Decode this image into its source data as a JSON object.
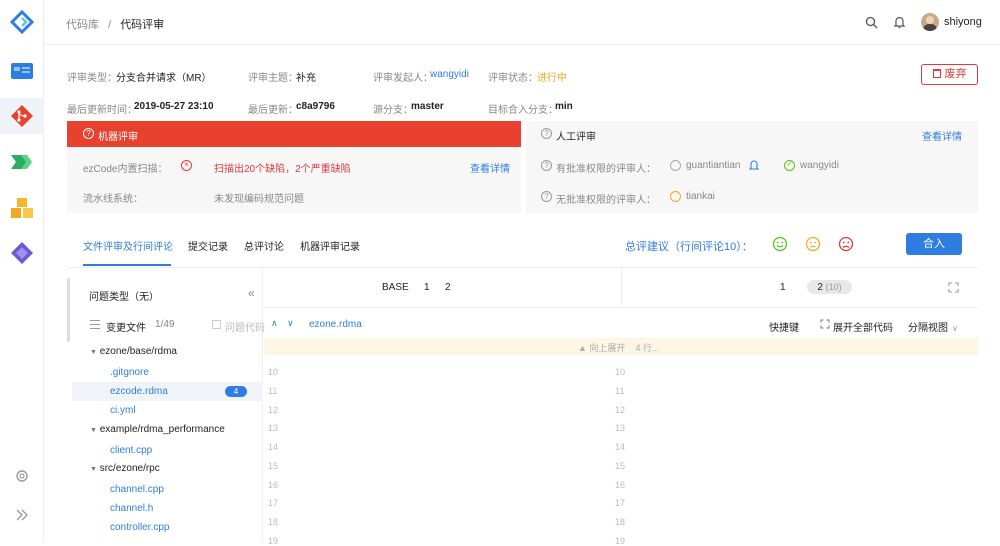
{
  "breadcrumb": {
    "root": "代码库",
    "sep": "/",
    "current": "代码评审"
  },
  "user": {
    "name": "shiyong"
  },
  "review": {
    "type_label": "评审类型：",
    "type_value": "分支合并请求（MR）",
    "topic_label": "评审主题：",
    "topic_value": "补充",
    "initiator_label": "评审发起人：",
    "initiator_value": "wangyidi",
    "status_label": "评审状态：",
    "status_value": "进行中",
    "updated_time_label": "最后更新时间：",
    "updated_time_value": "2019-05-27 23:10",
    "last_update_label": "最后更新：",
    "last_update_value": "c8a9796",
    "source_branch_label": "源分支：",
    "source_branch_value": "master",
    "target_branch_label": "目标合入分支：",
    "target_branch_value": "min",
    "discard_label": "废弃"
  },
  "machine_review": {
    "title": "机器评审",
    "scan_label": "ezCode内置扫描：",
    "scan_result": "扫描出20个缺陷，2个严重缺陷",
    "scan_detail": "查看详情",
    "pipeline_label": "流水线系统：",
    "pipeline_result": "未发现编码规范问题"
  },
  "manual_review": {
    "title": "人工评审",
    "detail": "查看详情",
    "authorized_label": "有批准权限的评审人：",
    "authorized_reviewers": [
      "guantiantian",
      "wangyidi"
    ],
    "unauthorized_label": "无批准权限的评审人：",
    "unauthorized_reviewers": [
      "tiankai"
    ]
  },
  "tabs": [
    "文件评审及行间评论",
    "提交记录",
    "总评讨论",
    "机器评审记录"
  ],
  "summary": {
    "label": "总评建议（行间评论10）：",
    "merge_label": "合入"
  },
  "file_panel": {
    "issue_type": "问题类型（无）",
    "changed_files_label": "变更文件",
    "changed_files_count": "1/49",
    "issue_code_label": "问题代码",
    "tree": [
      {
        "label": "ezone/base/rdma",
        "type": "folder"
      },
      {
        "label": ".gitgnore",
        "type": "file"
      },
      {
        "label": "ezcode.rdma",
        "type": "file",
        "badge": "4"
      },
      {
        "label": "ci.yml",
        "type": "file"
      },
      {
        "label": "example/rdma_performance",
        "type": "folder"
      },
      {
        "label": "client.cpp",
        "type": "file"
      },
      {
        "label": "src/ezone/rpc",
        "type": "folder"
      },
      {
        "label": "channel.cpp",
        "type": "file"
      },
      {
        "label": "channel.h",
        "type": "file"
      },
      {
        "label": "controller.cpp",
        "type": "file"
      }
    ]
  },
  "diff": {
    "base_label": "BASE",
    "left_versions": [
      "1",
      "2"
    ],
    "right_versions": [
      "1",
      "2"
    ],
    "right_count": "(10)",
    "filename": "ezone.rdma",
    "shortcut_label": "快捷键",
    "expand_all_label": "展开全部代码",
    "view_label": "分隔视图",
    "expand_up_label": "向上展开",
    "expand_rows_label": "4 行...",
    "line_numbers": [
      "10",
      "11",
      "12",
      "13",
      "14",
      "15",
      "16",
      "17",
      "18",
      "19"
    ]
  },
  "colors": {
    "accent": "#2f7de1",
    "danger": "#e8412f",
    "warning": "#f5a623",
    "success": "#52c41a"
  }
}
